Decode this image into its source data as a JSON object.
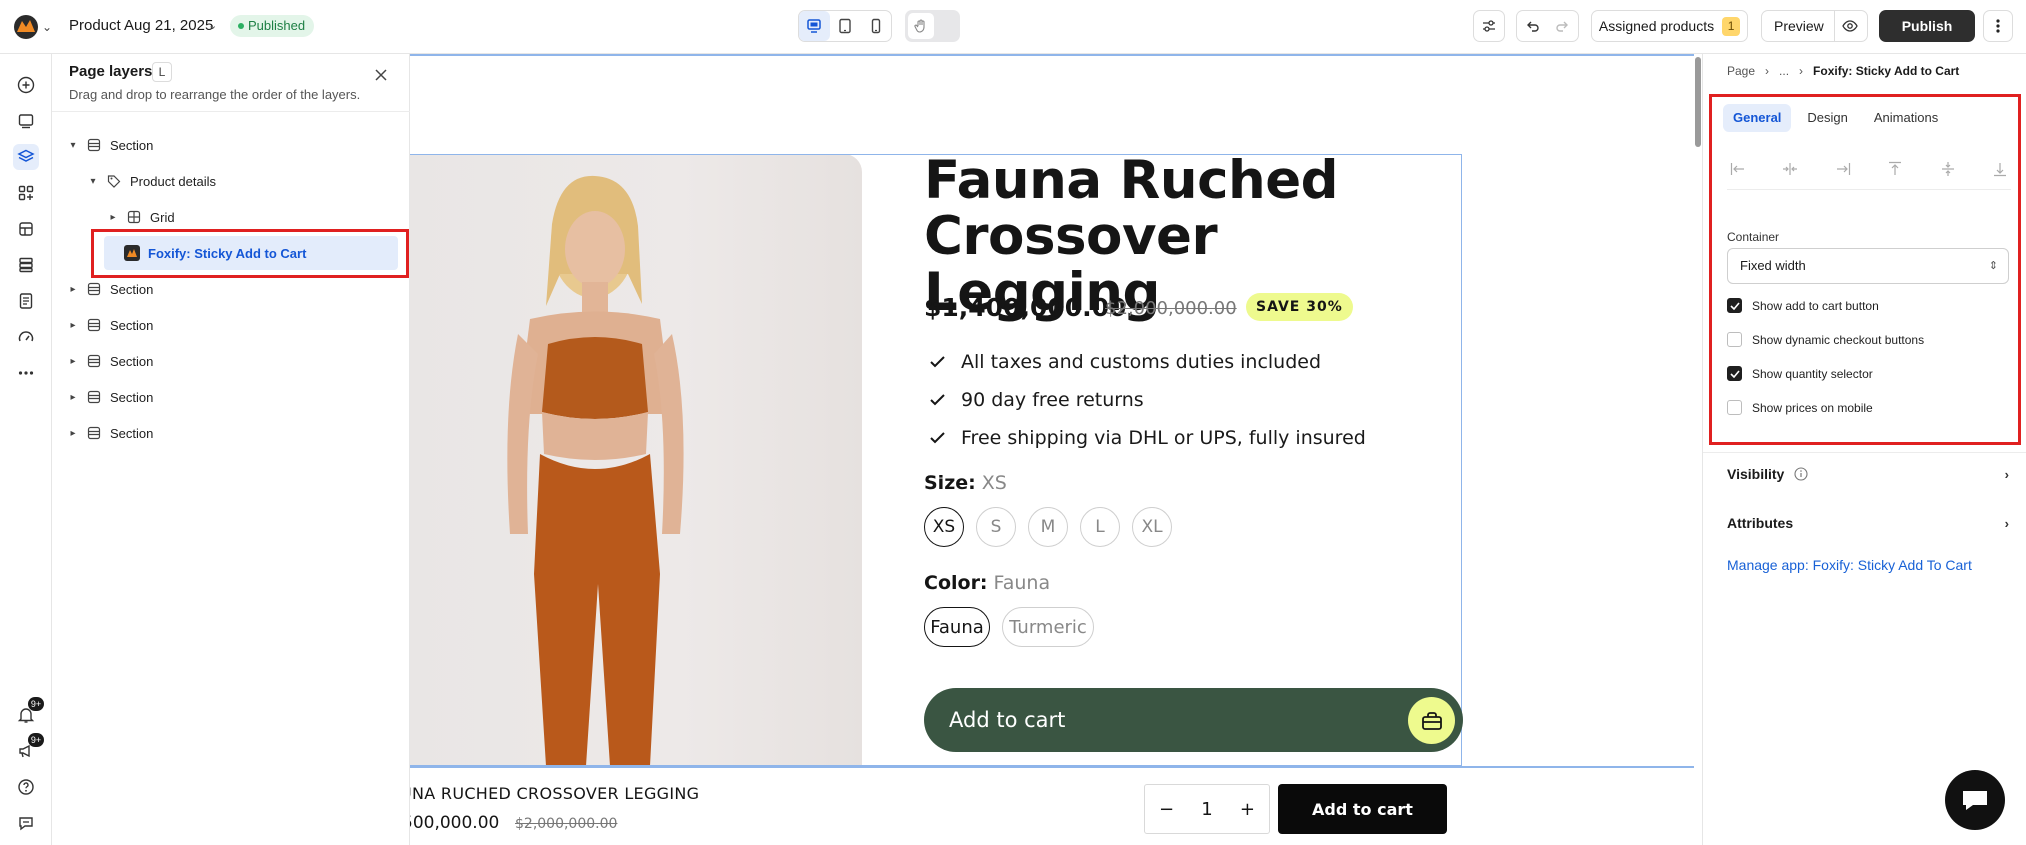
{
  "topbar": {
    "page_title": "Product Aug 21, 2025",
    "status": "Published",
    "assigned_label": "Assigned products",
    "assigned_count": "1",
    "preview_label": "Preview",
    "publish_label": "Publish"
  },
  "rail": {
    "notification_badge": "9+",
    "messages_badge": "9+"
  },
  "layers": {
    "title": "Page layers",
    "shortcut": "L",
    "subtitle": "Drag and drop to rearrange the order of the layers.",
    "items": [
      {
        "label": "Section",
        "expanded": true
      },
      {
        "label": "Product details",
        "expanded": true
      },
      {
        "label": "Grid",
        "expanded": false
      },
      {
        "label": "Foxify: Sticky Add to Cart",
        "selected": true
      },
      {
        "label": "Section"
      },
      {
        "label": "Section"
      },
      {
        "label": "Section"
      },
      {
        "label": "Section"
      },
      {
        "label": "Section"
      }
    ]
  },
  "product": {
    "title": "Fauna Ruched Crossover Legging",
    "price": "$1,400,000.00",
    "compare_price": "$2,000,000.00",
    "save_badge": "SAVE 30%",
    "benefits": [
      "All taxes and customs duties included",
      "90 day free returns",
      "Free shipping via DHL or UPS, fully insured"
    ],
    "size_label": "Size:",
    "size_value": "XS",
    "sizes": [
      "XS",
      "S",
      "M",
      "L",
      "XL"
    ],
    "color_label": "Color:",
    "color_value": "Fauna",
    "colors": [
      "Fauna",
      "Turmeric"
    ],
    "add_to_cart": "Add to cart"
  },
  "sticky": {
    "name": "UNA RUCHED CROSSOVER LEGGING",
    "price": "500,000.00",
    "compare_price": "$2,000,000.00",
    "minus": "−",
    "quantity": "1",
    "plus": "+",
    "add_to_cart": "Add to cart"
  },
  "settings": {
    "breadcrumb": [
      "Page",
      "...",
      "Foxify: Sticky Add to Cart"
    ],
    "tabs": [
      "General",
      "Design",
      "Animations"
    ],
    "container_label": "Container",
    "container_value": "Fixed width",
    "checkboxes": [
      {
        "label": "Show add to cart button",
        "checked": true
      },
      {
        "label": "Show dynamic checkout buttons",
        "checked": false
      },
      {
        "label": "Show quantity selector",
        "checked": true
      },
      {
        "label": "Show prices on mobile",
        "checked": false
      }
    ],
    "visibility_label": "Visibility",
    "attributes_label": "Attributes",
    "manage_link": "Manage app: Foxify: Sticky Add To Cart"
  },
  "colors": {
    "accent": "#1456d6",
    "highlight_red": "#e02020",
    "atc_green": "#3a5542",
    "save_yellow": "#eefa8e"
  }
}
